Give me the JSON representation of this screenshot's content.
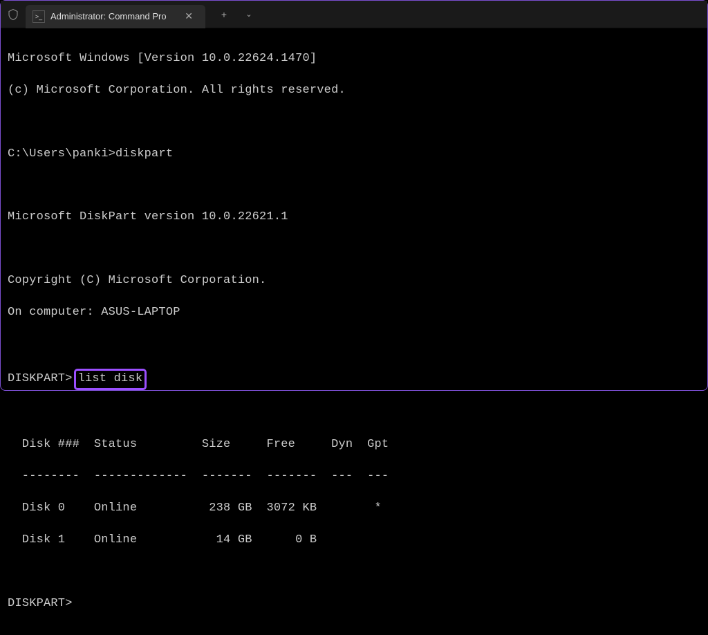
{
  "tab": {
    "title": "Administrator: Command Pro"
  },
  "terminal": {
    "line1": "Microsoft Windows [Version 10.0.22624.1470]",
    "line2": "(c) Microsoft Corporation. All rights reserved.",
    "prompt1": "C:\\Users\\panki>",
    "cmd1": "diskpart",
    "line4": "Microsoft DiskPart version 10.0.22621.1",
    "line5": "Copyright (C) Microsoft Corporation.",
    "line6": "On computer: ASUS-LAPTOP",
    "prompt2": "DISKPART>",
    "cmd2": "list disk",
    "table_header": "  Disk ###  Status         Size     Free     Dyn  Gpt",
    "table_divider": "  --------  -------------  -------  -------  ---  ---",
    "row1": "  Disk 0    Online          238 GB  3072 KB        *",
    "row2": "  Disk 1    Online           14 GB      0 B",
    "prompt3": "DISKPART>"
  }
}
